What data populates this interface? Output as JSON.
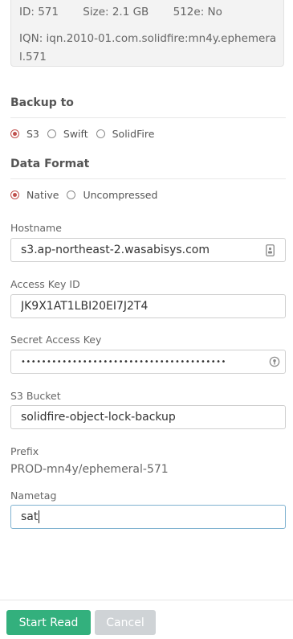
{
  "volume": {
    "id": "ID: 571",
    "size": "Size: 2.1 GB",
    "e512": "512e: No",
    "iqn": "IQN: iqn.2010-01.com.solidfire:mn4y.ephemeral.571"
  },
  "backup_to": {
    "title": "Backup to",
    "options": [
      "S3",
      "Swift",
      "SolidFire"
    ],
    "selected": "S3"
  },
  "data_format": {
    "title": "Data Format",
    "options": [
      "Native",
      "Uncompressed"
    ],
    "selected": "Native"
  },
  "fields": {
    "hostname": {
      "label": "Hostname",
      "value": "s3.ap-northeast-2.wasabisys.com"
    },
    "access_key": {
      "label": "Access Key ID",
      "value": "JK9X1AT1LBI20EI7J2T4"
    },
    "secret_key": {
      "label": "Secret Access Key",
      "value": "••••••••••••••••••••••••••••••••••••••••"
    },
    "bucket": {
      "label": "S3 Bucket",
      "value": "solidfire-object-lock-backup"
    },
    "prefix": {
      "label": "Prefix",
      "value": "PROD-mn4y/ephemeral-571"
    },
    "nametag": {
      "label": "Nametag",
      "value": "sat"
    }
  },
  "buttons": {
    "start": "Start Read",
    "cancel": "Cancel"
  },
  "colors": {
    "primary": "#33b07d",
    "radio_accent": "#c0504d",
    "cancel": "#cfd3d6"
  }
}
